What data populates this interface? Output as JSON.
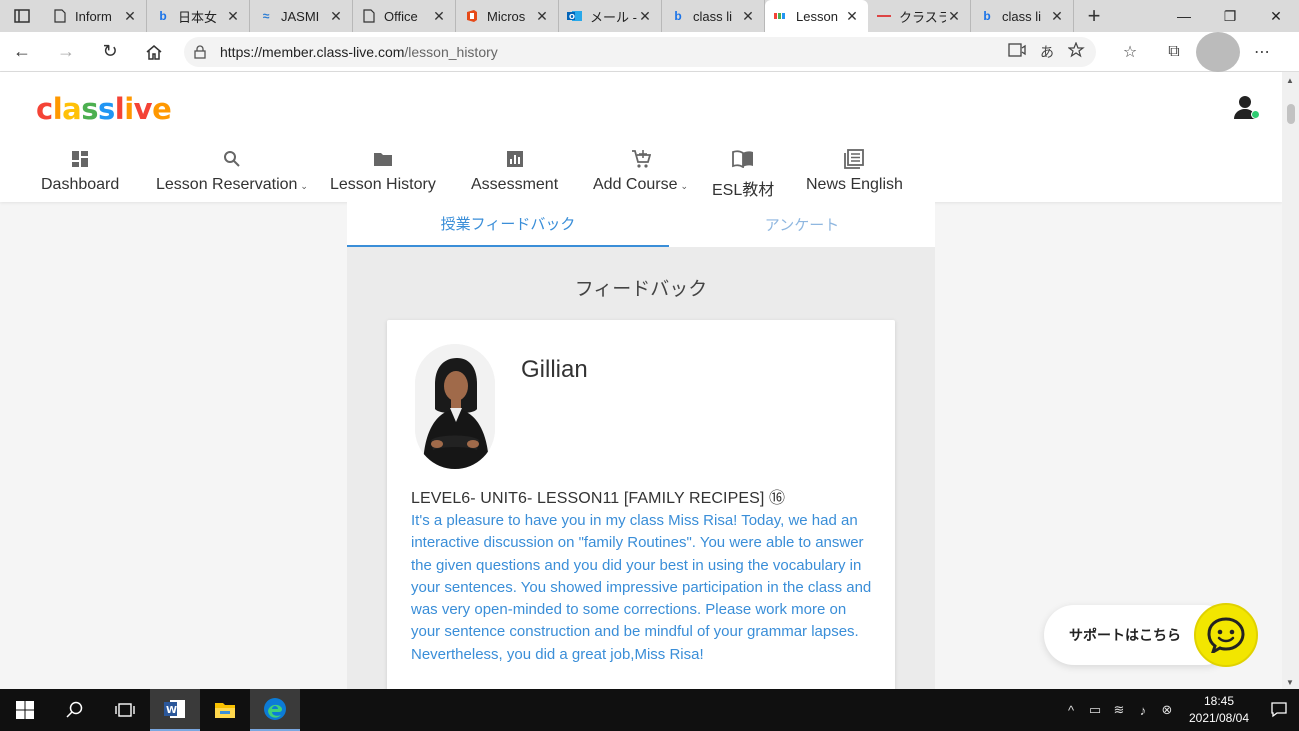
{
  "browser": {
    "tabs": [
      {
        "title": "Inform",
        "icon": "page-icon",
        "active": false
      },
      {
        "title": "日本女",
        "icon": "bing-icon",
        "active": false
      },
      {
        "title": "JASMI",
        "icon": "jasmine-icon",
        "active": false
      },
      {
        "title": "Office",
        "icon": "page-icon",
        "active": false
      },
      {
        "title": "Micros",
        "icon": "office-icon",
        "active": false
      },
      {
        "title": "メール -",
        "icon": "outlook-icon",
        "active": false
      },
      {
        "title": "class li",
        "icon": "bing-icon",
        "active": false
      },
      {
        "title": "Lesson",
        "icon": "classlive-icon",
        "active": true
      },
      {
        "title": "クラスラ",
        "icon": "site-icon",
        "active": false
      },
      {
        "title": "class li",
        "icon": "bing-icon",
        "active": false
      }
    ],
    "url_host": "https://member.class-live.com",
    "url_path": "/lesson_history",
    "translate_label": "あ"
  },
  "site": {
    "logo": {
      "c": "c",
      "l": "l",
      "a": "a",
      "s1": "s",
      "s2": "s",
      "l2": "l",
      "i": "i",
      "v": "v",
      "e": "e"
    },
    "menu": [
      {
        "label": "Dashboard",
        "icon": "dashboard-icon",
        "has_caret": false
      },
      {
        "label": "Lesson Reservation",
        "icon": "search-icon",
        "has_caret": true
      },
      {
        "label": "Lesson History",
        "icon": "folder-icon",
        "has_caret": false
      },
      {
        "label": "Assessment",
        "icon": "bar-chart-icon",
        "has_caret": false
      },
      {
        "label": "Add Course",
        "icon": "cart-add-icon",
        "has_caret": true
      },
      {
        "label": "ESL教材",
        "icon": "book-icon",
        "has_caret": false
      },
      {
        "label": "News English",
        "icon": "news-icon",
        "has_caret": false
      }
    ],
    "caret": "⌄"
  },
  "content": {
    "sub_tabs": [
      {
        "label": "授業フィードバック",
        "active": true
      },
      {
        "label": "アンケート",
        "active": false
      }
    ],
    "section_title": "フィードバック",
    "card": {
      "teacher_name": "Gillian",
      "lesson_title": "LEVEL6- UNIT6- LESSON11 [FAMILY RECIPES] ⑯",
      "feedback": "It's a pleasure to have you in my class Miss Risa! Today, we had an interactive discussion on \"family Routines\". You were able to answer the given questions and you did your best in using the vocabulary in your sentences. You showed impressive participation in the class and was very open-minded to some corrections. Please work more on your sentence construction and be mindful of your grammar lapses. Nevertheless, you did a great job,Miss Risa!"
    }
  },
  "support": {
    "label": "サポートはこちら"
  },
  "taskbar": {
    "time": "18:45",
    "date": "2021/08/04"
  },
  "colors": {
    "accent_blue": "#3a8ed8",
    "support_yellow": "#f2e600",
    "status_green": "#2ecc71"
  }
}
